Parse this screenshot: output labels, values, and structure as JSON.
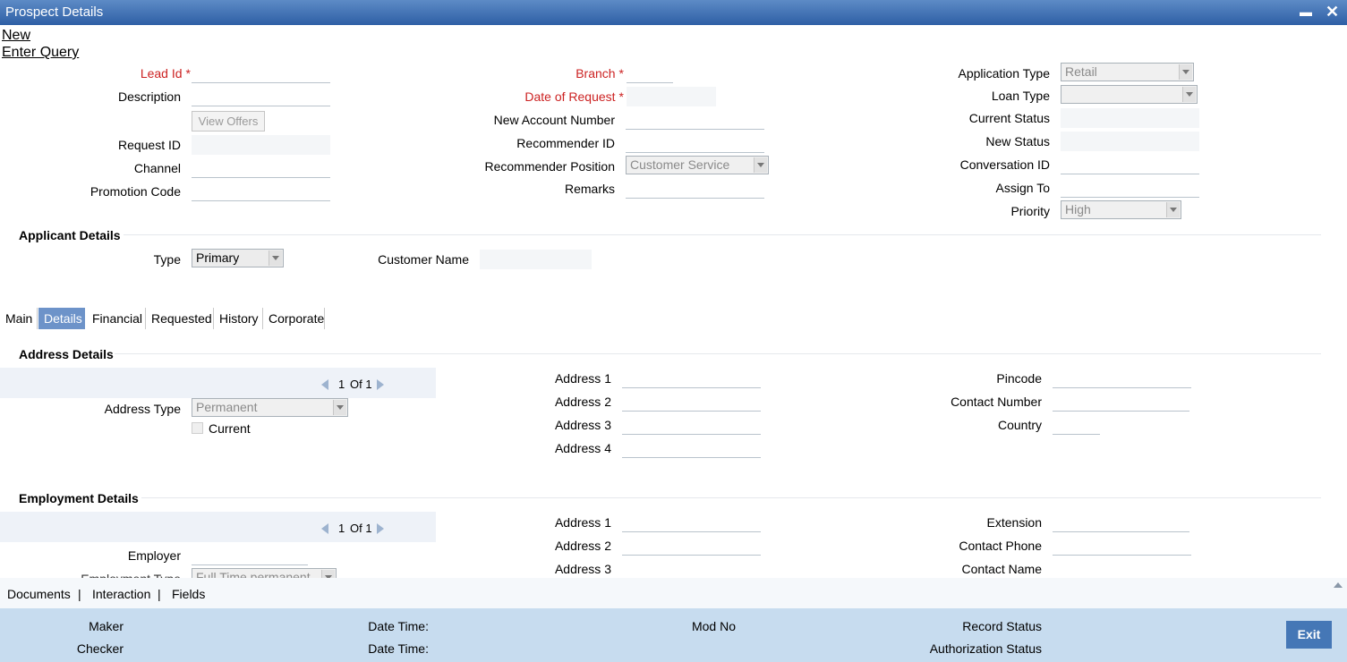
{
  "window": {
    "title": "Prospect Details",
    "minimize": "▬",
    "close": "✕"
  },
  "actions": {
    "new": "New",
    "enter_query": "Enter Query"
  },
  "header": {
    "lead_id": "Lead Id",
    "description": "Description",
    "view_offers": "View Offers",
    "request_id": "Request ID",
    "channel": "Channel",
    "promotion_code": "Promotion Code",
    "branch": "Branch",
    "date_of_request": "Date of Request",
    "new_account_number": "New Account Number",
    "recommender_id": "Recommender ID",
    "recommender_position": "Recommender Position",
    "recommender_position_value": "Customer Service",
    "remarks": "Remarks",
    "application_type": "Application Type",
    "application_type_value": "Retail",
    "loan_type": "Loan Type",
    "loan_type_value": "",
    "current_status": "Current Status",
    "new_status": "New Status",
    "conversation_id": "Conversation ID",
    "assign_to": "Assign To",
    "priority": "Priority",
    "priority_value": "High",
    "required_marker": "*"
  },
  "applicant": {
    "section": "Applicant Details",
    "type": "Type",
    "type_value": "Primary",
    "customer_name": "Customer Name"
  },
  "tabs": [
    "Main",
    "Details",
    "Financial",
    "Requested",
    "History",
    "Corporate"
  ],
  "active_tab": "Details",
  "address": {
    "section": "Address Details",
    "pager_current": "1",
    "pager_text": "Of 1",
    "address_type": "Address Type",
    "address_type_value": "Permanent",
    "current": "Current",
    "address1": "Address 1",
    "address2": "Address 2",
    "address3": "Address 3",
    "address4": "Address 4",
    "pincode": "Pincode",
    "contact_number": "Contact Number",
    "country": "Country"
  },
  "employment": {
    "section": "Employment Details",
    "pager_current": "1",
    "pager_text": "Of 1",
    "employer": "Employer",
    "employment_type": "Employment Type",
    "employment_type_value": "Full Time permanent",
    "address1": "Address 1",
    "address2": "Address 2",
    "address3": "Address 3",
    "extension": "Extension",
    "contact_phone": "Contact Phone",
    "contact_name": "Contact Name"
  },
  "bottom_links": {
    "documents": "Documents",
    "sep1": "|",
    "interaction": "Interaction",
    "sep2": "|",
    "fields": "Fields"
  },
  "footer": {
    "maker": "Maker",
    "checker": "Checker",
    "date_time_1": "Date Time:",
    "date_time_2": "Date Time:",
    "mod_no": "Mod No",
    "record_status": "Record Status",
    "authorization_status": "Authorization Status",
    "exit": "Exit"
  },
  "colors": {
    "title_bar": "#2e5fa5",
    "active_tab": "#6d93c9",
    "required": "#cc2222",
    "footer": "#c7dcef",
    "exit_button": "#4577b6"
  }
}
